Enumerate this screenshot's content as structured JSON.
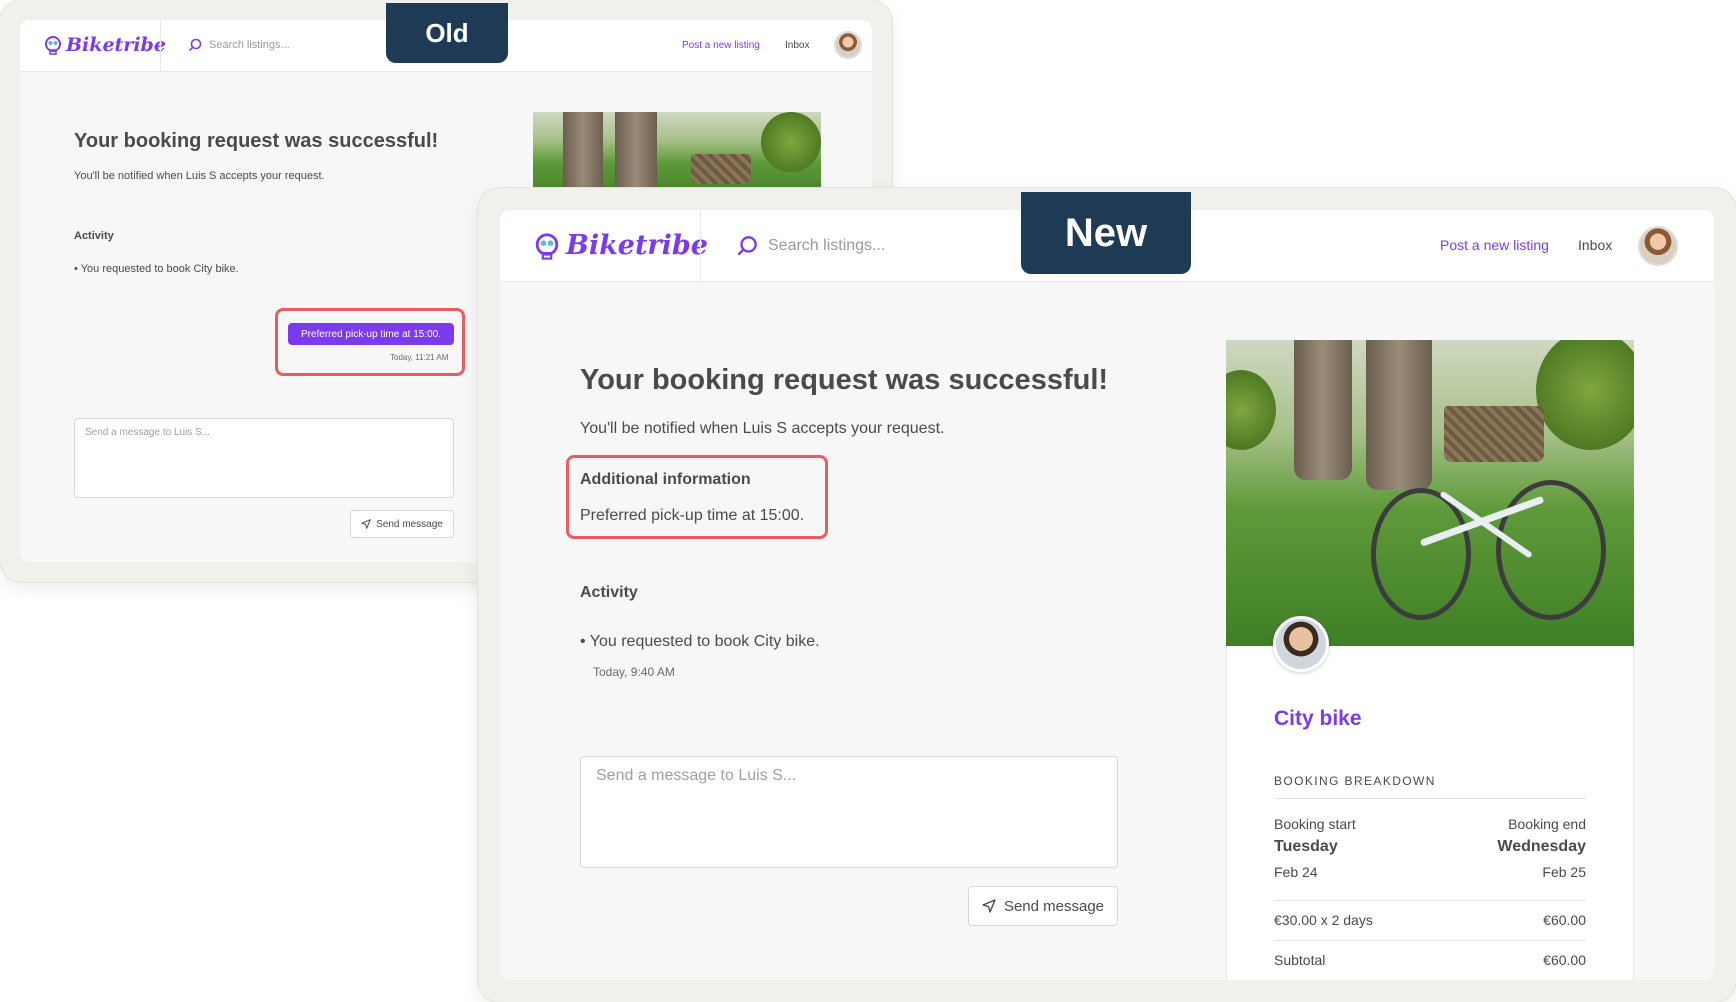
{
  "old": {
    "badge": "Old",
    "brand": "Biketribe",
    "search_placeholder": "Search listings...",
    "post_listing": "Post a new listing",
    "inbox": "Inbox",
    "heading": "Your booking request was successful!",
    "subtext": "You'll be notified when Luis S accepts your request.",
    "activity_label": "Activity",
    "activity_item": "You requested to book City bike.",
    "message_bubble": "Preferred pick-up time at 15:00.",
    "message_time": "Today, 11:21 AM",
    "message_placeholder": "Send a message to Luis S...",
    "send_button": "Send message"
  },
  "new": {
    "badge": "New",
    "brand": "Biketribe",
    "search_placeholder": "Search listings...",
    "post_listing": "Post a new listing",
    "inbox": "Inbox",
    "heading": "Your booking request was successful!",
    "subtext": "You'll be notified when Luis S accepts your request.",
    "additional_info_label": "Additional information",
    "additional_info_value": "Preferred pick-up time at 15:00.",
    "activity_label": "Activity",
    "activity_item": "You requested to book City bike.",
    "activity_time": "Today, 9:40 AM",
    "message_placeholder": "Send a message to Luis S...",
    "send_button": "Send message",
    "listing": {
      "title": "City bike",
      "breakdown_label": "BOOKING BREAKDOWN",
      "booking_start_label": "Booking start",
      "booking_start_day": "Tuesday",
      "booking_start_date": "Feb 24",
      "booking_end_label": "Booking end",
      "booking_end_day": "Wednesday",
      "booking_end_date": "Feb 25",
      "rate_label": "€30.00 x 2 days",
      "rate_value": "€60.00",
      "subtotal_label": "Subtotal",
      "subtotal_value": "€60.00"
    }
  },
  "colors": {
    "brand": "#7c3aed",
    "badge": "#1f3a54",
    "highlight": "#e85d63"
  }
}
